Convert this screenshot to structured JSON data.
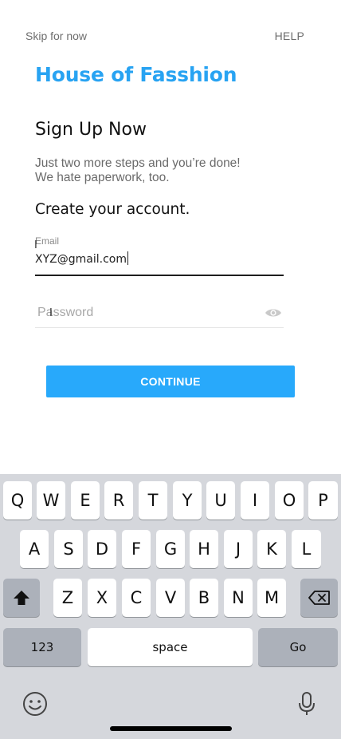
{
  "header": {
    "skip_label": "Skip for now",
    "help_label": "HELP"
  },
  "brand": {
    "name": "House of Fasshion",
    "color": "#28a3f2"
  },
  "form": {
    "title": "Sign Up Now",
    "subtitle_line1": "Just two more steps and you’re done!",
    "subtitle_line2": "We hate paperwork, too.",
    "section_title": "Create your account.",
    "email_label": "Email",
    "email_value": "XYZ@gmail.com",
    "password_placeholder": "Password",
    "continue_label": "CONTINUE",
    "button_color": "#28a9fb"
  },
  "keyboard": {
    "row1": [
      "Q",
      "W",
      "E",
      "R",
      "T",
      "Y",
      "U",
      "I",
      "O",
      "P"
    ],
    "row2": [
      "A",
      "S",
      "D",
      "F",
      "G",
      "H",
      "J",
      "K",
      "L"
    ],
    "row3": [
      "Z",
      "X",
      "C",
      "V",
      "B",
      "N",
      "M"
    ],
    "numbers_label": "123",
    "space_label": "space",
    "go_label": "Go",
    "icons": {
      "shift": "shift-icon",
      "backspace": "backspace-icon",
      "emoji": "emoji-icon",
      "dictation": "microphone-icon"
    }
  }
}
